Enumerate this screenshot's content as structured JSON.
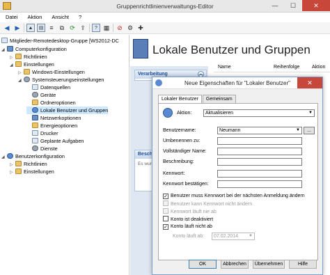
{
  "window": {
    "title": "Gruppenrichtlinienverwaltungs-Editor",
    "minimize": "—",
    "maximize": "☐",
    "close": "✕"
  },
  "menu": [
    "Datei",
    "Aktion",
    "Ansicht",
    "?"
  ],
  "tree": {
    "root": "Mitglieder-Remotedesktop-Gruppe [WS2012-DC",
    "computer": "Computerkonfiguration",
    "c_richtlinien": "Richtlinien",
    "c_einstellungen": "Einstellungen",
    "windows": "Windows-Einstellungen",
    "system": "Systemsteuerungseinstellungen",
    "datenquellen": "Datenquellen",
    "geraete": "Geräte",
    "ordner": "Ordneroptionen",
    "lokale": "Lokale Benutzer und Gruppen",
    "netzwerk": "Netzwerkoptionen",
    "energie": "Energieoptionen",
    "drucker": "Drucker",
    "aufgaben": "Geplante Aufgaben",
    "dienste": "Dienste",
    "benutzer": "Benutzerkonfiguration",
    "b_richtlinien": "Richtlinien",
    "b_einstellungen": "Einstellungen"
  },
  "main": {
    "header": "Lokale Benutzer und Gruppen",
    "panel1": "Verarbeitung",
    "panel2": "Beschr",
    "panel2_text": "Es wur ausger",
    "columns": [
      "Name",
      "Reihenfolge",
      "Aktion"
    ]
  },
  "dialog": {
    "title": "Neue Eigenschaften für \"Lokaler Benutzer\"",
    "tabs": [
      "Lokaler Benutzer",
      "Gemeinsam"
    ],
    "aktion_label": "Aktion:",
    "aktion_value": "Aktualisieren",
    "benutzername_label": "Benutzername:",
    "benutzername_value": "Neumann",
    "browse_label": "...",
    "umbenennen_label": "Umbenennen zu:",
    "vollstaendig_label": "Vollständiger Name:",
    "beschreibung_label": "Beschreibung:",
    "kennwort_label": "Kennwort:",
    "kennwort2_label": "Kennwort bestätigen:",
    "cb1": "Benutzer muss Kennwort bei der nächsten Anmeldung ändern",
    "cb2": "Benutzer kann Kennwort nicht ändern",
    "cb3": "Kennwort läuft nie ab",
    "cb4": "Konto ist deaktiviert",
    "cb5": "Konto läuft nicht ab",
    "expires_label": "Konto läuft ab:",
    "expires_value": "07.02.2014",
    "buttons": [
      "OK",
      "Abbrechen",
      "Übernehmen",
      "Hilfe"
    ]
  }
}
